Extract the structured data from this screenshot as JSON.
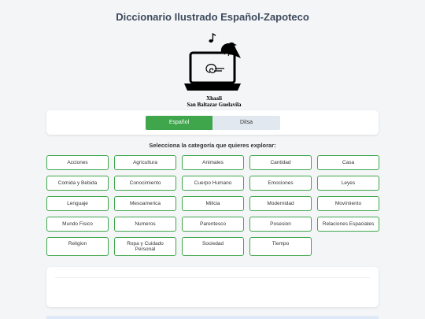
{
  "header": {
    "title": "Diccionario Ilustrado Español-Zapoteco"
  },
  "logo": {
    "icons": [
      "laptop-icon",
      "bird-icon",
      "music-note-icon",
      "spiral-icon"
    ],
    "line1": "Xhaali",
    "line2": "San Baltazar Guelavila"
  },
  "language": {
    "active": "Español",
    "inactive": "Ditsa"
  },
  "categories_prompt": "Selecciona la categoría que quieres explorar:",
  "categories": [
    "Acciones",
    "Agricultura",
    "Animales",
    "Cantidad",
    "Casa",
    "Comida y Bebida",
    "Conocimiento",
    "Cuerpo Humano",
    "Emociones",
    "Leyes",
    "Lenguaje",
    "Mesoamerica",
    "Milicia",
    "Modernidad",
    "Movimiento",
    "Mundo Fisico",
    "Numeros",
    "Parentesco",
    "Posesion",
    "Relaciones Espaciales",
    "Religion",
    "Ropa y Cuidado Personal",
    "Sociedad",
    "Tiempo"
  ],
  "colors": {
    "accent": "#3fa64b",
    "title": "#3d4a5c",
    "background": "#f4f5f7",
    "inactive_tab": "#e2e8f0"
  }
}
